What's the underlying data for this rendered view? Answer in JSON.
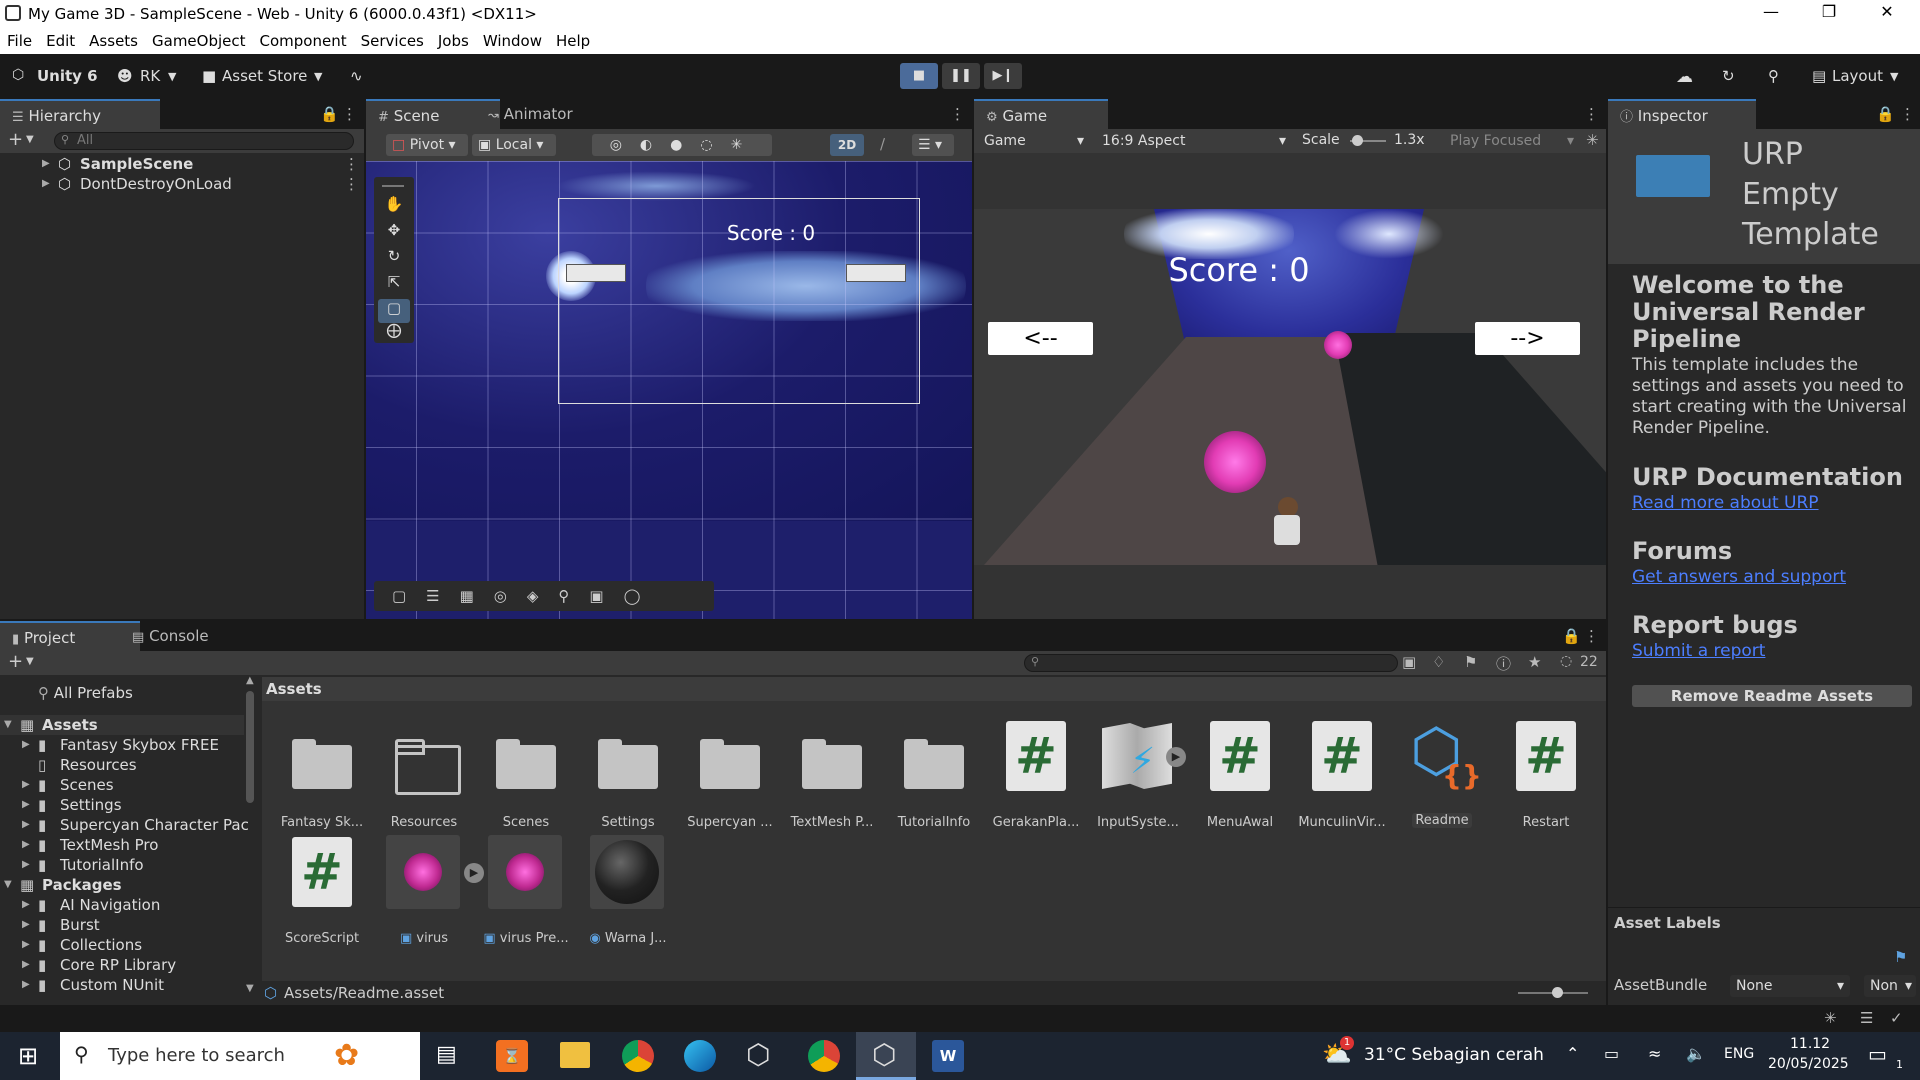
{
  "window": {
    "title": "My Game 3D - SampleScene - Web - Unity 6 (6000.0.43f1) <DX11>"
  },
  "menu": [
    "File",
    "Edit",
    "Assets",
    "GameObject",
    "Component",
    "Services",
    "Jobs",
    "Window",
    "Help"
  ],
  "toolbar": {
    "unity_label": "Unity 6",
    "account": "RK",
    "asset_store": "Asset Store",
    "layout": "Layout"
  },
  "hierarchy": {
    "tab": "Hierarchy",
    "search_placeholder": "All",
    "items": [
      "SampleScene",
      "DontDestroyOnLoad"
    ]
  },
  "scene": {
    "tab": "Scene",
    "animator_tab": "Animator",
    "pivot": "Pivot",
    "local": "Local",
    "mode_2d": "2D",
    "score_text": "Score : 0"
  },
  "game": {
    "tab": "Game",
    "display": "Game",
    "aspect": "16:9 Aspect",
    "scale_label": "Scale",
    "scale_value": "1.3x",
    "play_mode": "Play Focused",
    "score_text": "Score : 0",
    "left_button": "<--",
    "right_button": "-->"
  },
  "inspector": {
    "tab": "Inspector",
    "title_lines": [
      "URP",
      "Empty",
      "Template"
    ],
    "welcome_heading": "Welcome to the Universal Render Pipeline",
    "welcome_text": "This template includes the settings and assets you need to start creating with the Universal Render Pipeline.",
    "doc_heading": "URP Documentation",
    "doc_link": "Read more about URP",
    "forums_heading": "Forums",
    "forums_link": "Get answers and support",
    "bugs_heading": "Report bugs",
    "bugs_link": "Submit a report",
    "remove_button": "Remove Readme Assets",
    "asset_labels": "Asset Labels",
    "asset_bundle": "AssetBundle",
    "bundle_value": "None",
    "bundle_variant": "Non"
  },
  "project": {
    "tab": "Project",
    "console_tab": "Console",
    "count": "22",
    "favorites": "All Prefabs",
    "assets_root": "Assets",
    "asset_folders": [
      "Fantasy Skybox FREE",
      "Resources",
      "Scenes",
      "Settings",
      "Supercyan Character Pac",
      "TextMesh Pro",
      "TutorialInfo"
    ],
    "packages_root": "Packages",
    "package_folders": [
      "AI Navigation",
      "Burst",
      "Collections",
      "Core RP Library",
      "Custom NUnit"
    ],
    "breadcrumb": "Assets",
    "grid_row1": [
      "Fantasy Sk...",
      "Resources",
      "Scenes",
      "Settings",
      "Supercyan ...",
      "TextMesh P...",
      "TutorialInfo",
      "GerakanPla...",
      "InputSyste...",
      "MenuAwal",
      "MunculinVir...",
      "Readme",
      "Restart"
    ],
    "grid_row2": [
      "ScoreScript",
      "virus",
      "virus Pre...",
      "Warna J..."
    ],
    "status_path": "Assets/Readme.asset"
  },
  "taskbar": {
    "search_placeholder": "Type here to search",
    "weather": "31°C  Sebagian cerah",
    "lang": "ENG",
    "time": "11.12",
    "date": "20/05/2025",
    "notif": "1"
  },
  "colors": {
    "accent": "#3a79bb",
    "link": "#4c7eff",
    "virus": "#e23cb4",
    "scene_bg": "#1e1f6b"
  }
}
